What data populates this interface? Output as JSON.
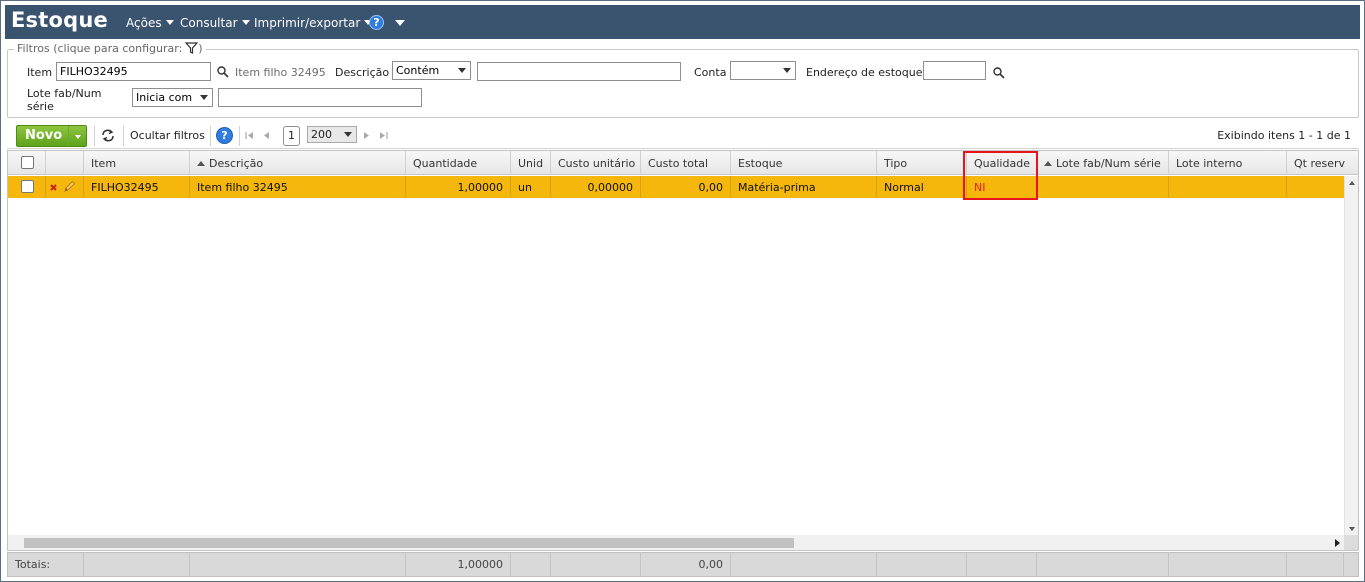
{
  "app": {
    "title": "Estoque",
    "menus": [
      {
        "label": "Ações"
      },
      {
        "label": "Consultar"
      },
      {
        "label": "Imprimir/exportar"
      }
    ],
    "help_symbol": "?"
  },
  "filters": {
    "legend": "Filtros (clique para configurar:",
    "item_label": "Item",
    "item_value": "FILHO32495",
    "item_hint": "Item filho 32495",
    "descricao_label": "Descrição",
    "descricao_mode": "Contém",
    "descricao_value": "",
    "conta_label": "Conta",
    "conta_value": "",
    "endereco_label": "Endereço de estoque",
    "endereco_value": "",
    "lote_label_line1": "Lote fab/Num",
    "lote_label_line2": "série",
    "lote_mode": "Inicia com",
    "lote_value": ""
  },
  "toolbar": {
    "novo_label": "Novo",
    "ocultar_filtros_label": "Ocultar filtros",
    "current_page": "1",
    "page_size": "200",
    "showing_text": "Exibindo itens 1 - 1 de 1"
  },
  "grid": {
    "columns": [
      {
        "label": "Item"
      },
      {
        "label": "Descrição",
        "sorted": "asc"
      },
      {
        "label": "Quantidade"
      },
      {
        "label": "Unid"
      },
      {
        "label": "Custo unitário"
      },
      {
        "label": "Custo total"
      },
      {
        "label": "Estoque"
      },
      {
        "label": "Tipo"
      },
      {
        "label": "Qualidade"
      },
      {
        "label": "Lote fab/Num série",
        "sorted": "asc"
      },
      {
        "label": "Lote interno"
      },
      {
        "label": "Qt reserv"
      }
    ],
    "rows": [
      {
        "item": "FILHO32495",
        "descricao": "Item filho 32495",
        "quantidade": "1,00000",
        "unid": "un",
        "custo_unitario": "0,00000",
        "custo_total": "0,00",
        "estoque": "Matéria-prima",
        "tipo": "Normal",
        "qualidade": "NI",
        "lote_fab": "",
        "lote_interno": "",
        "qt_reserv": ""
      }
    ],
    "selected_row_color": "#f5b70c",
    "highlight_color": "#e8141c"
  },
  "totals": {
    "label": "Totais:",
    "quantidade": "1,00000",
    "custo_total": "0,00"
  },
  "colors": {
    "header_bg": "#3a536f",
    "novo_green": "#6db52a",
    "quality_text": "#e02121"
  }
}
